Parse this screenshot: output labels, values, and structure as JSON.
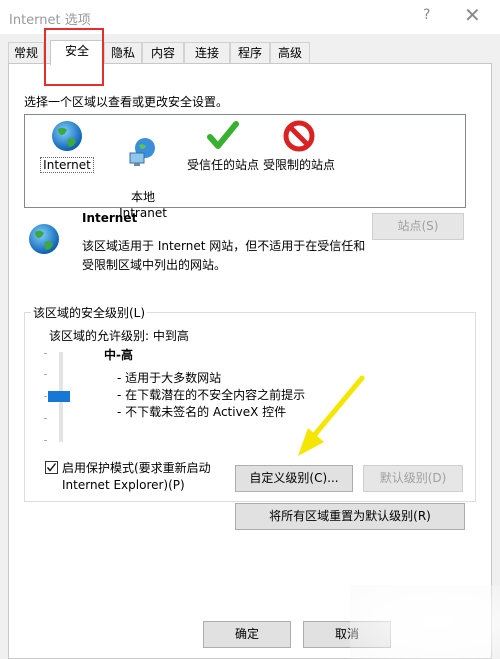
{
  "window": {
    "title": "Internet 选项",
    "help_glyph": "?",
    "close_glyph": "✕"
  },
  "tabs": [
    {
      "label": "常规"
    },
    {
      "label": "安全"
    },
    {
      "label": "隐私"
    },
    {
      "label": "内容"
    },
    {
      "label": "连接"
    },
    {
      "label": "程序"
    },
    {
      "label": "高级"
    }
  ],
  "security": {
    "zone_hint": "选择一个区域以查看或更改安全设置。",
    "zones": [
      {
        "label": "Internet",
        "icon": "globe-icon"
      },
      {
        "label": "本地\nIntranet",
        "icon": "intranet-icon"
      },
      {
        "label": "受信任的站点",
        "icon": "checkmark-icon"
      },
      {
        "label": "受限制的站点",
        "icon": "restricted-icon"
      }
    ],
    "selected_zone": {
      "name": "Internet",
      "description": "该区域适用于 Internet 网站，但不适用于在受信任和受限制区域中列出的网站。",
      "sites_button": "站点(S)"
    },
    "level_group_title": "该区域的安全级别(L)",
    "allowed_levels": "该区域的允许级别: 中到高",
    "level_name": "中-高",
    "level_points": [
      "- 适用于大多数网站",
      "- 在下载潜在的不安全内容之前提示",
      "- 不下载未签名的 ActiveX 控件"
    ],
    "slider_level": 0.5,
    "protected_mode_label": "启用保护模式(要求重新启动 Internet Explorer)(P)",
    "protected_mode_checked": true,
    "custom_level_button": "自定义级别(C)...",
    "default_level_button": "默认级别(D)",
    "reset_all_button": "将所有区域重置为默认级别(R)"
  },
  "footer": {
    "ok_button": "确定",
    "cancel_button": "取消"
  },
  "colors": {
    "accent": "#1777d6",
    "highlight": "#e03030",
    "annotation_arrow": "#f5e600"
  }
}
